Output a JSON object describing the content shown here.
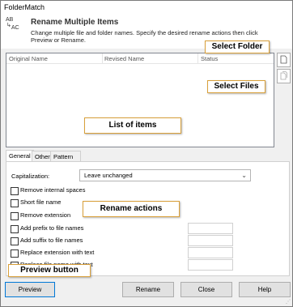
{
  "window": {
    "title": "FolderMatch"
  },
  "header": {
    "icon_top": "AB",
    "icon_bottom": "AC",
    "icon_arrow": "↳",
    "title": "Rename Multiple Items",
    "description": "Change multiple file and folder names. Specify the desired rename actions then click Preview or Rename."
  },
  "list": {
    "columns": [
      "Original Name",
      "Revised Name",
      "Status"
    ]
  },
  "side_buttons": [
    {
      "name": "select-folder-icon"
    },
    {
      "name": "select-files-icon"
    }
  ],
  "tabs": [
    {
      "label": "General",
      "active": true
    },
    {
      "label": "Other",
      "active": false
    },
    {
      "label": "Pattern matching",
      "active": false
    }
  ],
  "general": {
    "capitalization_label": "Capitalization:",
    "capitalization_value": "Leave unchanged",
    "options": [
      {
        "label": "Remove internal spaces",
        "checked": false,
        "has_text": false
      },
      {
        "label": "Short file name",
        "checked": false,
        "has_text": false
      },
      {
        "label": "Remove extension",
        "checked": false,
        "has_text": false
      },
      {
        "label": "Add prefix to file names",
        "checked": false,
        "has_text": true
      },
      {
        "label": "Add suffix to file names",
        "checked": false,
        "has_text": true
      },
      {
        "label": "Replace extension with text",
        "checked": false,
        "has_text": true
      },
      {
        "label": "Replace file name with text",
        "checked": false,
        "has_text": true
      }
    ]
  },
  "buttons": {
    "preview": "Preview",
    "rename": "Rename",
    "close": "Close",
    "help": "Help"
  },
  "annotations": {
    "select_folder": "Select Folder",
    "select_files": "Select Files",
    "list_of_items": "List of items",
    "rename_actions": "Rename actions",
    "preview_button": "Preview button"
  },
  "colors": {
    "callout_border": "#d9a03a",
    "focus_border": "#0078d7"
  }
}
